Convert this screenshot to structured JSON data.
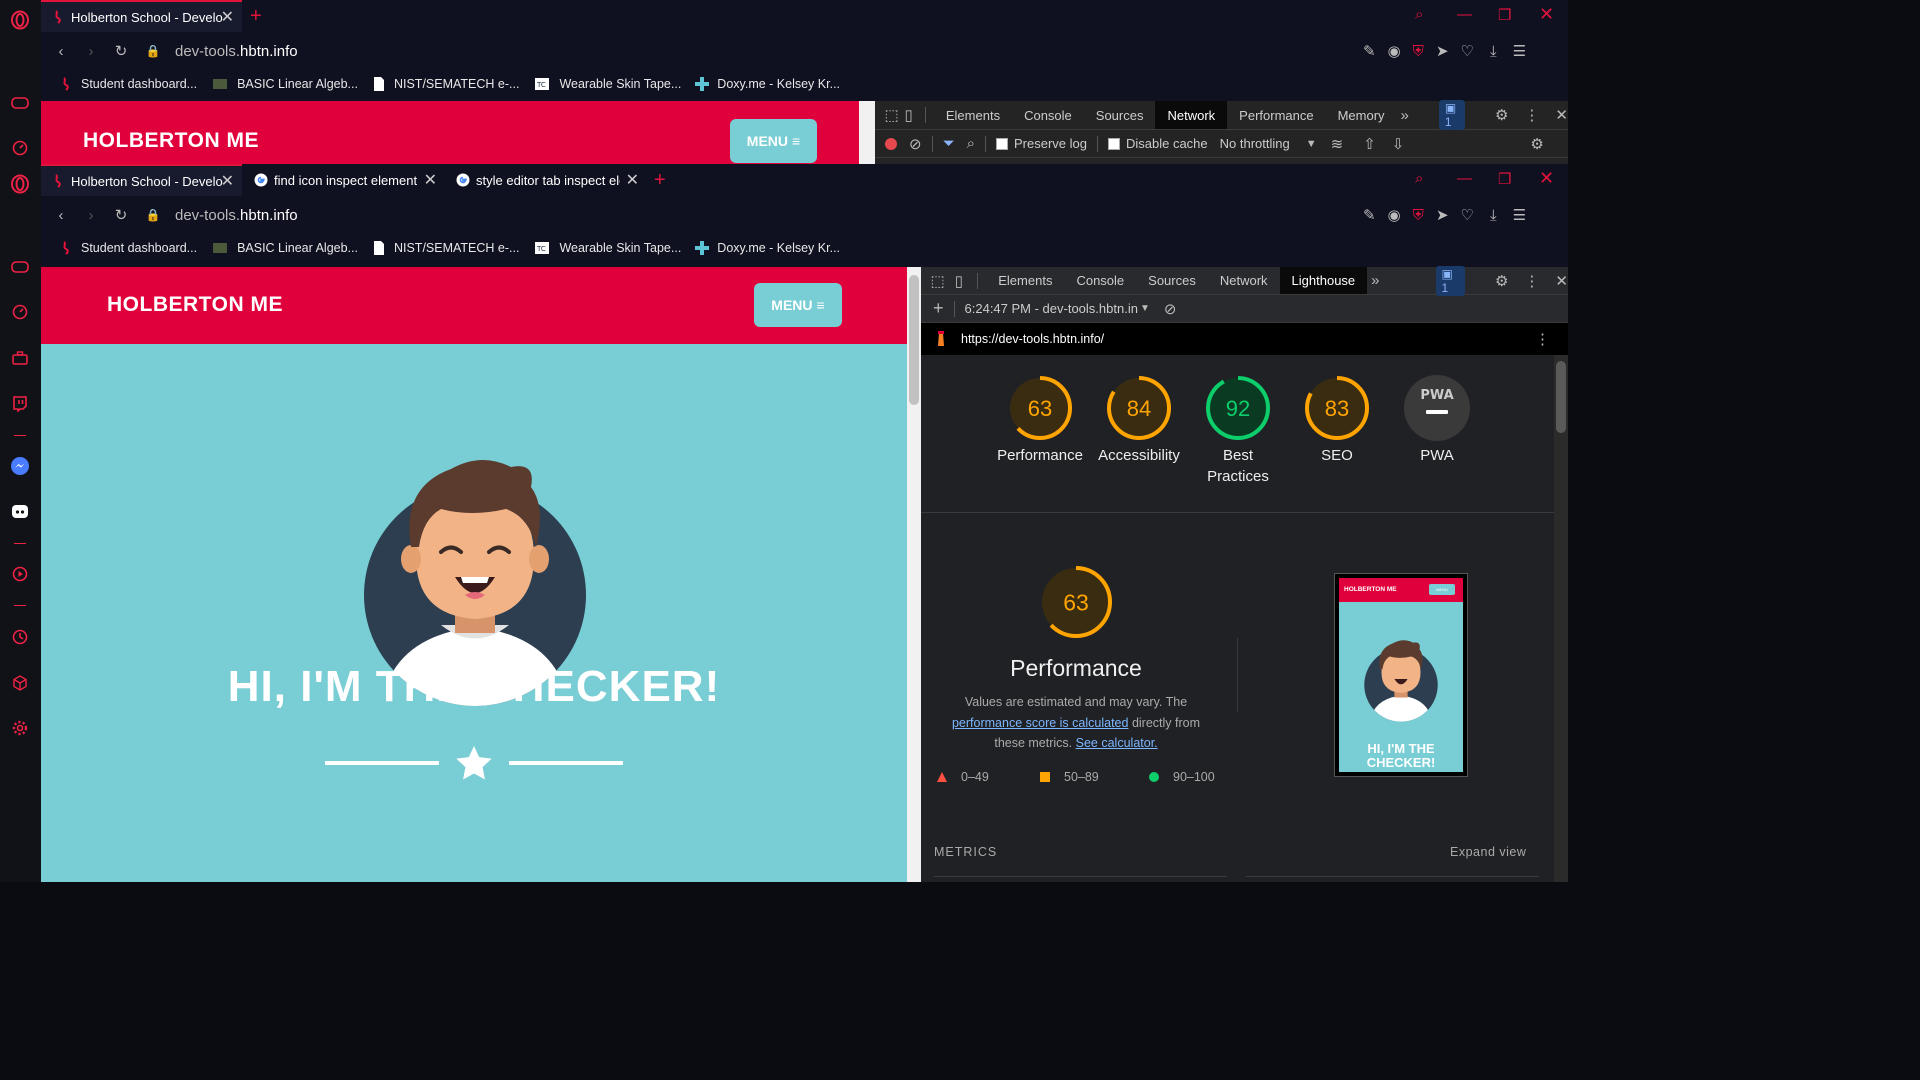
{
  "sidebar": {
    "icons": [
      "opera-logo-icon",
      "controller-icon",
      "speedometer-icon",
      "opera-logo-icon",
      "controller-icon",
      "speedometer-icon",
      "briefcase-icon",
      "twitch-icon",
      "messenger-icon",
      "discord-icon",
      "player-icon",
      "history-icon",
      "cube-icon",
      "gear-icon"
    ]
  },
  "top_window": {
    "tabs": [
      {
        "title": "Holberton School - Develo",
        "active": true
      }
    ],
    "url_host_prefix": "dev-tools.",
    "url_host_main": "hbtn.info",
    "site_title": "HOLBERTON ME",
    "menu_label": "MENU",
    "devtools_tabs": [
      "Elements",
      "Console",
      "Sources",
      "Network",
      "Performance",
      "Memory"
    ],
    "devtools_active": "Network",
    "issues_count": "1",
    "network_toolbar": {
      "preserve_log": "Preserve log",
      "disable_cache": "Disable cache",
      "throttling": "No throttling"
    }
  },
  "bookmarks": [
    {
      "label": "Student dashboard...",
      "icon": "holberton-icon"
    },
    {
      "label": "BASIC Linear Algeb...",
      "icon": "image-icon"
    },
    {
      "label": "NIST/SEMATECH e-...",
      "icon": "document-icon"
    },
    {
      "label": "Wearable Skin Tape...",
      "icon": "tc-icon"
    },
    {
      "label": "Doxy.me - Kelsey Kr...",
      "icon": "cross-icon"
    }
  ],
  "main_window": {
    "tabs": [
      {
        "title": "Holberton School - Develo",
        "active": true
      },
      {
        "title": "find icon inspect element -",
        "active": false
      },
      {
        "title": "style editor tab inspect ele",
        "active": false
      }
    ],
    "url_host_prefix": "dev-tools.",
    "url_host_main": "hbtn.info",
    "site_title": "HOLBERTON ME",
    "menu_label": "MENU",
    "hero_heading": "HI, I'M THE CHECKER!",
    "devtools_tabs": [
      "Elements",
      "Console",
      "Sources",
      "Network",
      "Lighthouse"
    ],
    "devtools_active": "Lighthouse",
    "issues_count": "1",
    "lighthouse_report_select": "6:24:47 PM - dev-tools.hbtn.in",
    "lighthouse_url": "https://dev-tools.hbtn.info/"
  },
  "lighthouse": {
    "scores": [
      {
        "label": "Performance",
        "value": 63,
        "status": "average"
      },
      {
        "label": "Accessibility",
        "value": 84,
        "status": "average"
      },
      {
        "label": "Best Practices",
        "value": 92,
        "status": "pass"
      },
      {
        "label": "SEO",
        "value": 83,
        "status": "average"
      },
      {
        "label": "PWA",
        "value": null,
        "status": "na",
        "badge": "PWA"
      }
    ],
    "performance_detail": {
      "score": 63,
      "title": "Performance",
      "desc_before": "Values are estimated and may vary. The",
      "desc_link1": "performance score is calculated",
      "desc_middle": "directly from these metrics.",
      "desc_link2": "See calculator.",
      "legend": [
        "0–49",
        "50–89",
        "90–100"
      ]
    },
    "thumbnail": {
      "title": "HOLBERTON ME",
      "menu": "MENU",
      "heading": "HI, I'M THE CHECKER!"
    },
    "metrics_label": "METRICS",
    "expand_label": "Expand view"
  },
  "colors": {
    "brand_red": "#e0003b",
    "teal": "#79cdd4",
    "score_orange": "#ffa400",
    "score_green": "#0cce6b",
    "score_red": "#ff4e42"
  }
}
